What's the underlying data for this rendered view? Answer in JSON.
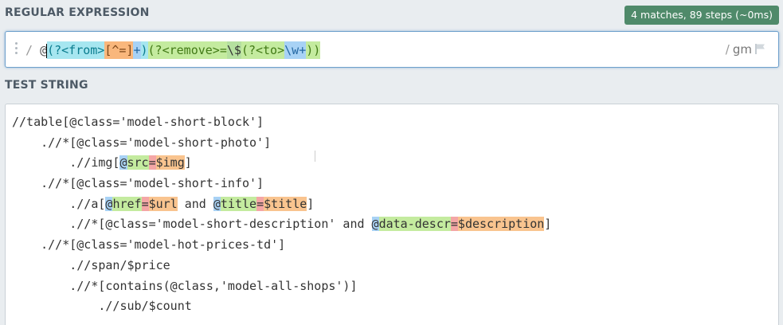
{
  "header": {
    "regex_title": "REGULAR EXPRESSION",
    "status": "4 matches, 89 steps (~0ms)",
    "test_title": "TEST STRING"
  },
  "regex": {
    "open_delim": "/",
    "at": "@",
    "g1_open": "(?<from>",
    "charset": "[^=]",
    "plus": "+",
    "g1_close": ")",
    "g2_open": "(?<remove>",
    "eq": "=",
    "esc_dollar": "\\$",
    "g3_open": "(?<to>",
    "word": "\\w",
    "g3_plus": "+",
    "g3_close": ")",
    "g2_close": ")",
    "close_delim": "/",
    "flags": "gm"
  },
  "test": {
    "l1": "//table[@class='model-short-block']",
    "l2": "    .//*[@class='model-short-photo']",
    "l3_pre": "        .//img[",
    "l3_at": "@",
    "l3_name": "src",
    "l3_eq": "=",
    "l3_val": "$img",
    "l3_post": "]",
    "l4": "    .//*[@class='model-short-info']",
    "l5_pre": "        .//a[",
    "l5_at1": "@",
    "l5_name1": "href",
    "l5_eq1": "=",
    "l5_val1": "$url",
    "l5_mid": " and ",
    "l5_at2": "@",
    "l5_name2": "title",
    "l5_eq2": "=",
    "l5_val2": "$title",
    "l5_post": "]",
    "l6_pre": "        .//*[@class='model-short-description' and ",
    "l6_at": "@",
    "l6_name": "data-descr",
    "l6_eq": "=",
    "l6_val": "$description",
    "l6_post": "]",
    "l7": "    .//*[@class='model-hot-prices-td']",
    "l8": "        .//span/$price",
    "l9": "        .//*[contains(@class,'model-all-shops')]",
    "l10": "            .//sub/$count"
  }
}
